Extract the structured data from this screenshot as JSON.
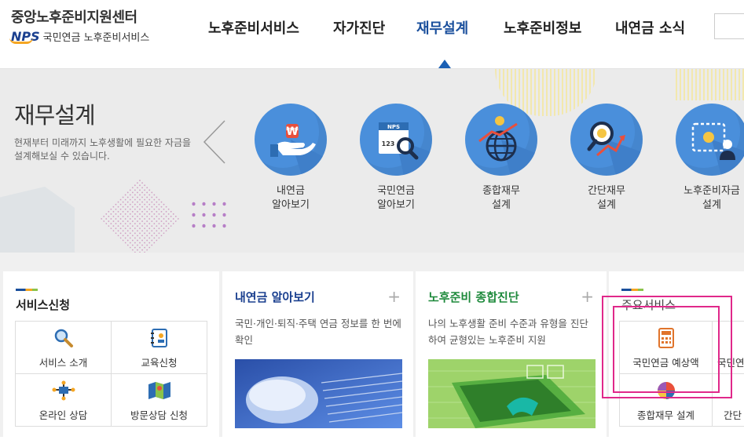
{
  "header": {
    "title": "중앙노후준비지원센터",
    "brand_mark": "NPS",
    "brand_sub": "국민연금 노후준비서비스",
    "nav": [
      {
        "label": "노후준비서비스",
        "active": false
      },
      {
        "label": "자가진단",
        "active": false
      },
      {
        "label": "재무설계",
        "active": true
      },
      {
        "label": "노후준비정보",
        "active": false
      },
      {
        "label": "내연금 소식",
        "active": false
      }
    ]
  },
  "hero": {
    "title": "재무설계",
    "description": "현재부터 미래까지 노후생활에 필요한 자금을 설계해보실 수 있습니다.",
    "services": [
      {
        "line1": "내연금",
        "line2": "알아보기",
        "icon": "hand-coin-icon"
      },
      {
        "line1": "국민연금",
        "line2": "알아보기",
        "icon": "nps-search-icon",
        "icon_text_1": "NPS",
        "icon_text_2": "123"
      },
      {
        "line1": "종합재무",
        "line2": "설계",
        "icon": "globe-chart-icon"
      },
      {
        "line1": "간단재무",
        "line2": "설계",
        "icon": "magnifier-chart-icon"
      },
      {
        "line1": "노후준비자금",
        "line2": "설계",
        "icon": "target-person-icon"
      }
    ]
  },
  "panels": {
    "service_request": {
      "title": "서비스신청",
      "items": [
        "서비스 소개",
        "교육신청",
        "온라인 상담",
        "방문상담 신청"
      ]
    },
    "my_pension": {
      "title": "내연금 알아보기",
      "plus": "+",
      "description": "국민·개인·퇴직·주택 연금 정보를 한 번에 확인"
    },
    "diagnosis": {
      "title": "노후준비 종합진단",
      "plus": "+",
      "description": "나의 노후생활 준비 수준과 유형을 진단하여 균형있는 노후준비 지원"
    },
    "main_services": {
      "title": "주요서비스",
      "items": [
        "국민연금 예상액",
        "국민연",
        "종합재무 설계",
        "간단"
      ]
    }
  },
  "colors": {
    "brand_blue": "#1a4f9c",
    "circle_blue": "#4a8fdb",
    "highlight": "#e0288a",
    "green_title": "#1e8a3c"
  }
}
